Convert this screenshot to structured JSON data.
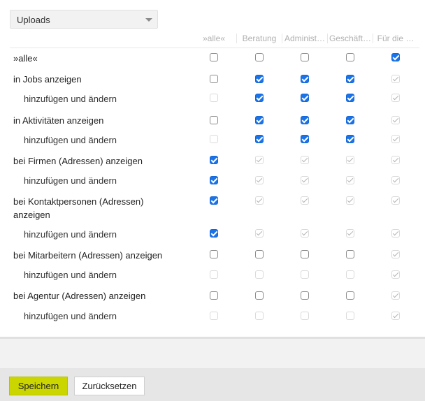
{
  "filter": {
    "selected": "Uploads"
  },
  "columns": [
    "»alle«",
    "Beratung",
    "Administ…",
    "Geschäft…",
    "Für die …"
  ],
  "rows": [
    {
      "label": "»alle«",
      "sub": false,
      "states": [
        "off",
        "off",
        "off",
        "off",
        "on"
      ]
    },
    {
      "label": "in Jobs anzeigen",
      "sub": false,
      "states": [
        "off",
        "on",
        "on",
        "on",
        "dis-on"
      ]
    },
    {
      "label": "hinzufügen und ändern",
      "sub": true,
      "states": [
        "dis",
        "on",
        "on",
        "on",
        "dis-on"
      ]
    },
    {
      "label": "in Aktivitäten anzeigen",
      "sub": false,
      "states": [
        "off",
        "on",
        "on",
        "on",
        "dis-on"
      ]
    },
    {
      "label": "hinzufügen und ändern",
      "sub": true,
      "states": [
        "dis",
        "on",
        "on",
        "on",
        "dis-on"
      ]
    },
    {
      "label": "bei Firmen (Adressen) anzeigen",
      "sub": false,
      "states": [
        "on",
        "dis-on",
        "dis-on",
        "dis-on",
        "dis-on"
      ]
    },
    {
      "label": "hinzufügen und ändern",
      "sub": true,
      "states": [
        "on",
        "dis-on",
        "dis-on",
        "dis-on",
        "dis-on"
      ]
    },
    {
      "label": "bei Kontaktpersonen (Adressen) anzeigen",
      "label_lines": [
        "bei Kontaktpersonen (Adressen)",
        "anzeigen"
      ],
      "sub": false,
      "states": [
        "on",
        "dis-on",
        "dis-on",
        "dis-on",
        "dis-on"
      ]
    },
    {
      "label": "hinzufügen und ändern",
      "sub": true,
      "states": [
        "on",
        "dis-on",
        "dis-on",
        "dis-on",
        "dis-on"
      ]
    },
    {
      "label": "bei Mitarbeitern (Adressen) anzeigen",
      "sub": false,
      "states": [
        "off",
        "off",
        "off",
        "off",
        "dis-on"
      ]
    },
    {
      "label": "hinzufügen und ändern",
      "sub": true,
      "states": [
        "dis",
        "dis",
        "dis",
        "dis",
        "dis-on"
      ]
    },
    {
      "label": "bei Agentur (Adressen) anzeigen",
      "sub": false,
      "states": [
        "off",
        "off",
        "off",
        "off",
        "dis-on"
      ]
    },
    {
      "label": "hinzufügen und ändern",
      "sub": true,
      "states": [
        "dis",
        "dis",
        "dis",
        "dis",
        "dis-on"
      ]
    }
  ],
  "actions": {
    "save": "Speichern",
    "reset": "Zurücksetzen"
  }
}
